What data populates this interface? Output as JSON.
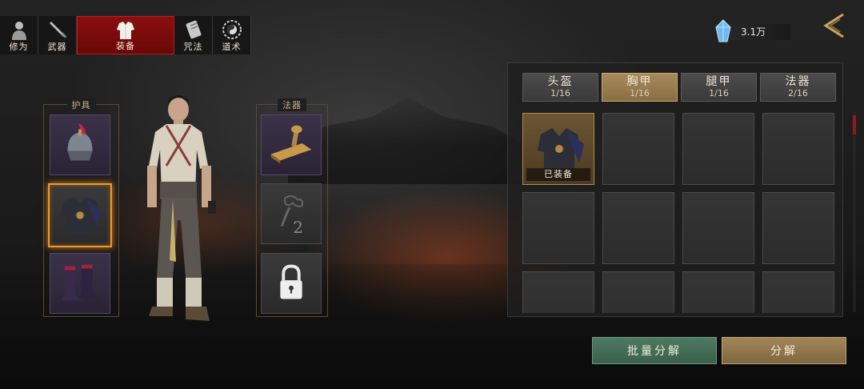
{
  "nav": {
    "tabs": [
      {
        "label": "修为",
        "icon": "cultivation-icon",
        "active": false
      },
      {
        "label": "武器",
        "icon": "weapon-icon",
        "active": false
      },
      {
        "label": "装备",
        "icon": "armor-icon",
        "active": true
      },
      {
        "label": "咒法",
        "icon": "spell-scroll-icon",
        "active": false
      },
      {
        "label": "道术",
        "icon": "taiji-icon",
        "active": false
      }
    ]
  },
  "currency": {
    "value": "3.1万",
    "icon": "crystal-icon"
  },
  "equipment": {
    "left_title": "护具",
    "right_title": "法器",
    "left_slots": [
      {
        "item": "helmet",
        "icon": "helmet-icon"
      },
      {
        "item": "chest-armor",
        "icon": "chest-armor-icon",
        "selected": true
      },
      {
        "item": "boots",
        "icon": "boots-icon"
      }
    ],
    "right_slots": [
      {
        "item": "stamp",
        "icon": "seal-stamp-icon"
      },
      {
        "item": "empty",
        "number": "2",
        "icon": "cloud-icon"
      },
      {
        "item": "locked",
        "icon": "lock-icon"
      }
    ]
  },
  "categories": [
    {
      "name": "头盔",
      "count": "1/16",
      "active": false
    },
    {
      "name": "胸甲",
      "count": "1/16",
      "active": true
    },
    {
      "name": "腿甲",
      "count": "1/16",
      "active": false
    },
    {
      "name": "法器",
      "count": "2/16",
      "active": false
    }
  ],
  "inventory": {
    "equipped_label": "已装备"
  },
  "buttons": {
    "batch_decompose": "批量分解",
    "decompose": "分解"
  },
  "colors": {
    "active_tab": "#8a0f0f",
    "selected_border": "#f39a1e",
    "batch_button": "#4f7a62",
    "decompose_button": "#a18659"
  }
}
